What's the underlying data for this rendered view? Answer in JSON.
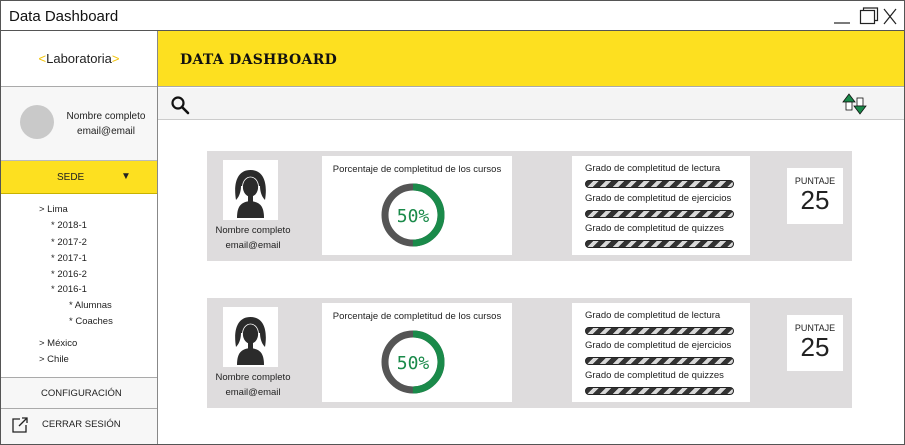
{
  "window": {
    "title": "Data Dashboard"
  },
  "sidebar": {
    "logo_left": "<",
    "logo_text": "Laboratoria",
    "logo_right": ">",
    "profile": {
      "name": "Nombre completo",
      "email": "email@email"
    },
    "sede_label": "SEDE",
    "sede_arrow": "▼",
    "tree": [
      {
        "label": "> Lima",
        "level": 0
      },
      {
        "label": "* 2018-1",
        "level": 1
      },
      {
        "label": "* 2017-2",
        "level": 1
      },
      {
        "label": "* 2017-1",
        "level": 1
      },
      {
        "label": "* 2016-2",
        "level": 1
      },
      {
        "label": "* 2016-1",
        "level": 1
      },
      {
        "label": "* Alumnas",
        "level": 2
      },
      {
        "label": "* Coaches",
        "level": 2
      },
      {
        "label": "> México",
        "level": 0
      },
      {
        "label": "> Chile",
        "level": 0
      }
    ],
    "config_label": "CONFIGURACIÓN",
    "logout_label": "CERRAR SESIÓN"
  },
  "header": {
    "title": "DATA DASHBOARD"
  },
  "colors": {
    "accent": "#fde020",
    "progress": "#1a8a4a",
    "track": "#555555"
  },
  "cards": [
    {
      "name": "Nombre completo",
      "email": "email@email",
      "progress_label": "Porcentaje de completitud de los cursos",
      "progress_value": "50%",
      "progress_fraction": 0.5,
      "grades": [
        {
          "label": "Grado de completitud de lectura"
        },
        {
          "label": "Grado de completitud de ejercicios"
        },
        {
          "label": "Grado de completitud de quizzes"
        }
      ],
      "score_label": "PUNTAJE",
      "score_value": "25"
    },
    {
      "name": "Nombre completo",
      "email": "email@email",
      "progress_label": "Porcentaje de completitud de los cursos",
      "progress_value": "50%",
      "progress_fraction": 0.5,
      "grades": [
        {
          "label": "Grado de completitud de lectura"
        },
        {
          "label": "Grado de completitud de ejercicios"
        },
        {
          "label": "Grado de completitud de quizzes"
        }
      ],
      "score_label": "PUNTAJE",
      "score_value": "25"
    }
  ]
}
